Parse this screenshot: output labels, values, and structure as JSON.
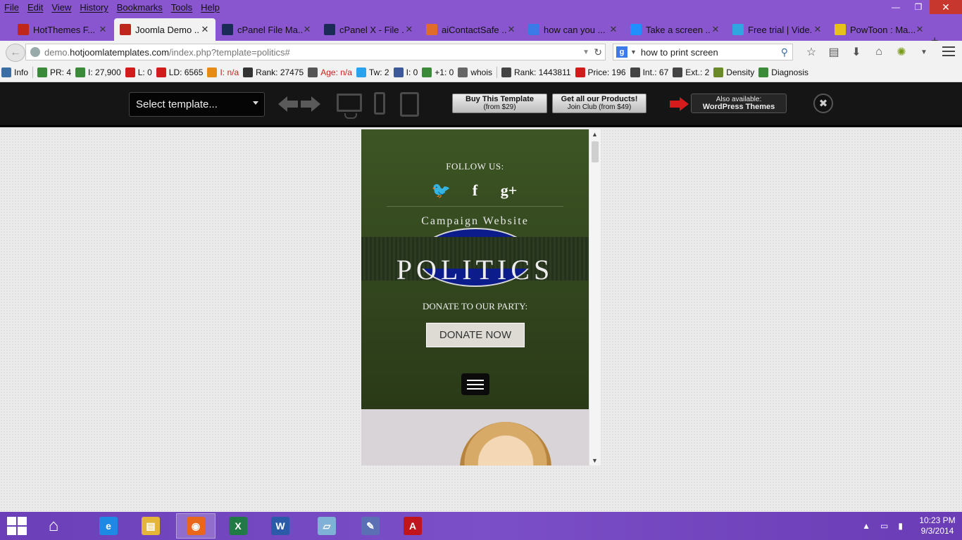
{
  "menubar": {
    "items": [
      "File",
      "Edit",
      "View",
      "History",
      "Bookmarks",
      "Tools",
      "Help"
    ]
  },
  "window": {
    "minimize_glyph": "—",
    "restore_glyph": "❐",
    "close_glyph": "✕"
  },
  "tabs": [
    {
      "title": "HotThemes F...",
      "icon": "hotthemes-icon",
      "color": "#c0271b",
      "active": false
    },
    {
      "title": "Joomla Demo ...",
      "icon": "hotthemes-icon",
      "color": "#c0271b",
      "active": true
    },
    {
      "title": "cPanel File Ma...",
      "icon": "hostgator-icon",
      "color": "#1a2b55",
      "active": false
    },
    {
      "title": "cPanel X - File ...",
      "icon": "hostgator-icon",
      "color": "#1a2b55",
      "active": false
    },
    {
      "title": "aiContactSafe ...",
      "icon": "joomla-icon",
      "color": "#e06b2a",
      "active": false
    },
    {
      "title": "how can you ...",
      "icon": "google-icon",
      "color": "#3b7be8",
      "active": false
    },
    {
      "title": "Take a screen ...",
      "icon": "windows-icon",
      "color": "#1e90ff",
      "active": false
    },
    {
      "title": "Free trial | Vide...",
      "icon": "play-icon",
      "color": "#2fa6e0",
      "active": false
    },
    {
      "title": "PowToon : Ma...",
      "icon": "powtoon-icon",
      "color": "#e8c21c",
      "active": false
    }
  ],
  "tab_close_glyph": "✕",
  "newtab_glyph": "+",
  "nav": {
    "url_prefix": "demo.",
    "url_domain": "hotjoomlatemplates.com",
    "url_suffix": "/index.php?template=politics#",
    "search_value": "how to print screen",
    "search_engine_letter": "g"
  },
  "seo": [
    {
      "label": "Info",
      "icon": "info-icon",
      "color": "#3b6ea5"
    },
    {
      "label": "PR: 4",
      "icon": "google-pr-icon",
      "color": "#3a8a3a"
    },
    {
      "label": "I: 27,900",
      "icon": "google-index-icon",
      "color": "#3a8a3a"
    },
    {
      "label": "L: 0",
      "icon": "yahoo-links-icon",
      "color": "#d21b1b"
    },
    {
      "label": "LD: 6565",
      "icon": "semrush-icon",
      "color": "#d21b1b"
    },
    {
      "label": "I: n/a",
      "icon": "bing-icon",
      "color": "#e58b16",
      "red": true
    },
    {
      "label": "Rank: 27475",
      "icon": "alexa-icon",
      "color": "#333333"
    },
    {
      "label": "Age: n/a",
      "icon": "archive-icon",
      "color": "#555555",
      "red": true
    },
    {
      "label": "Tw: 2",
      "icon": "twitter-icon",
      "color": "#2aa3ef"
    },
    {
      "label": "I: 0",
      "icon": "facebook-icon",
      "color": "#3b5998"
    },
    {
      "label": "+1: 0",
      "icon": "google-plus-icon",
      "color": "#3a8a3a"
    },
    {
      "label": "whois",
      "icon": "whois-icon",
      "color": "#666666"
    },
    {
      "label": "Rank: 1443811",
      "icon": "source-icon",
      "color": "#444444"
    },
    {
      "label": "Price: 196",
      "icon": "semrush-rank-icon",
      "color": "#d21b1b"
    },
    {
      "label": "Int.: 67",
      "icon": "internal-links-icon",
      "color": "#444444"
    },
    {
      "label": "Ext.: 2",
      "icon": "external-links-icon",
      "color": "#444444"
    },
    {
      "label": "Density",
      "icon": "density-icon",
      "color": "#6a8a2a"
    },
    {
      "label": "Diagnosis",
      "icon": "diagnosis-icon",
      "color": "#3a8a3a"
    }
  ],
  "demo": {
    "select_label": "Select template...",
    "buy_l1": "Buy This Template",
    "buy_l2": "(from $29)",
    "club_l1": "Get all our Products!",
    "club_l2": "Join Club (from $49)",
    "wp_l1": "Also available:",
    "wp_l2": "WordPress Themes",
    "close_glyph": "✖"
  },
  "site": {
    "follow_label": "FOLLOW US:",
    "social": [
      {
        "glyph": "🐦",
        "name": "twitter-icon"
      },
      {
        "glyph": "f",
        "name": "facebook-icon"
      },
      {
        "glyph": "g+",
        "name": "google-plus-icon"
      }
    ],
    "campaign": "Campaign Website",
    "logo": "POLITICS",
    "donate_label": "DONATE TO OUR PARTY:",
    "donate_button": "DONATE NOW"
  },
  "scroll": {
    "up": "▲",
    "down": "▼"
  },
  "taskbar": {
    "apps": [
      {
        "name": "home-icon",
        "glyph": "⌂",
        "color": "transparent"
      },
      {
        "name": "internet-explorer-icon",
        "glyph": "e",
        "color": "#1e88e5"
      },
      {
        "name": "file-explorer-icon",
        "glyph": "▤",
        "color": "#e5b53a"
      },
      {
        "name": "firefox-icon",
        "glyph": "◉",
        "color": "#e8671b"
      },
      {
        "name": "excel-icon",
        "glyph": "X",
        "color": "#1f7a43"
      },
      {
        "name": "word-icon",
        "glyph": "W",
        "color": "#2b5ba8"
      },
      {
        "name": "notepad-icon",
        "glyph": "▱",
        "color": "#7fb0d6"
      },
      {
        "name": "paint-icon",
        "glyph": "✎",
        "color": "#5b6fb5"
      },
      {
        "name": "acrobat-icon",
        "glyph": "A",
        "color": "#c1141b"
      }
    ],
    "tray_icons": [
      "▲",
      "▭",
      "▮"
    ],
    "time": "10:23 PM",
    "date": "9/3/2014"
  }
}
